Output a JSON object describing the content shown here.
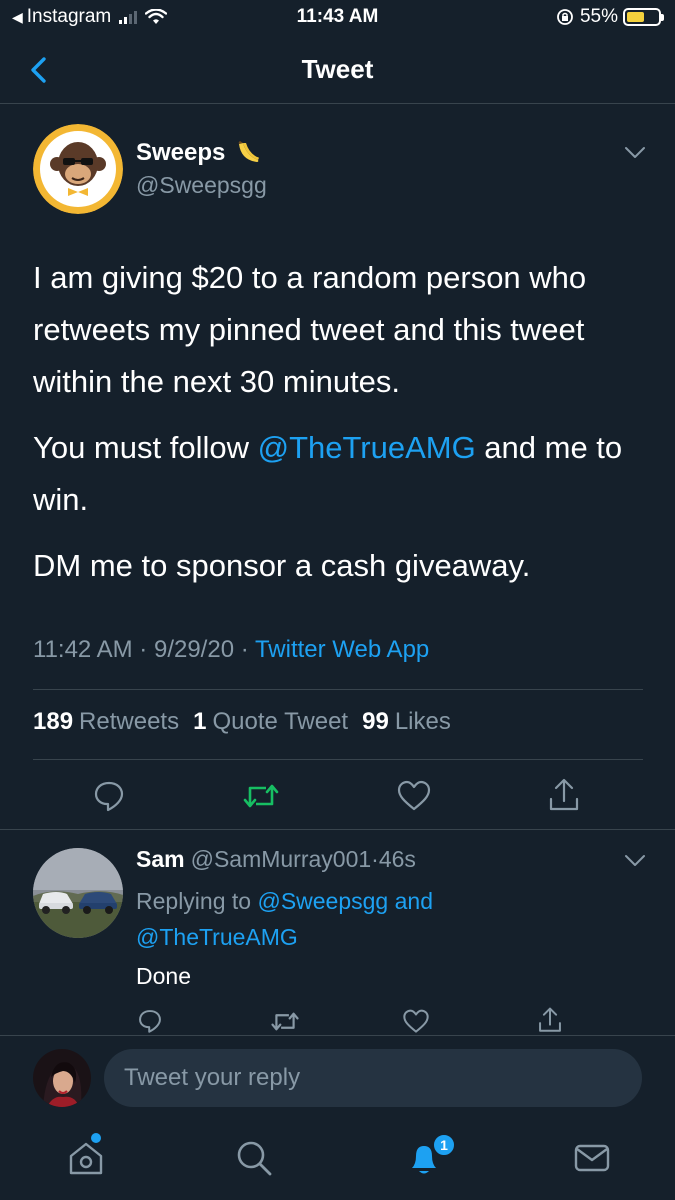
{
  "status_bar": {
    "back_app": "Instagram",
    "time": "11:43 AM",
    "battery": "55%",
    "battery_level": 0.55
  },
  "nav": {
    "title": "Tweet"
  },
  "tweet": {
    "author_name": "Sweeps",
    "author_emoji": "banana",
    "handle": "@Sweepsgg",
    "paragraphs": [
      {
        "text": "I am giving $20 to a random person who retweets my pinned tweet and this tweet within the next 30 minutes."
      },
      {
        "before": "You must follow ",
        "mention": "@TheTrueAMG",
        "after": " and me to win."
      },
      {
        "text": "DM me to sponsor a cash giveaway."
      }
    ],
    "time": "11:42 AM",
    "date": "9/29/20",
    "sep": "·",
    "source": "Twitter Web App",
    "stats": {
      "retweets_count": "189",
      "retweets_label": "Retweets",
      "quotes_count": "1",
      "quotes_label": "Quote Tweet",
      "likes_count": "99",
      "likes_label": "Likes"
    }
  },
  "reply": {
    "name": "Sam",
    "handle": "@SamMurray001",
    "sep": "·",
    "age": "46s",
    "replying_label": "Replying to",
    "replying_1": "@Sweepsgg",
    "and": "and",
    "replying_2": "@TheTrueAMG",
    "text": "Done"
  },
  "compose": {
    "placeholder": "Tweet your reply"
  },
  "tabbar": {
    "notifications_badge": "1"
  },
  "colors": {
    "background": "#15202b",
    "accent": "#1da1f2",
    "muted": "#8899a6",
    "retweet_green": "#17bf63",
    "divider": "#38444d"
  },
  "icons": [
    "chevron-left-icon",
    "banana-icon",
    "chevron-down-icon",
    "reply-icon",
    "retweet-icon",
    "like-icon",
    "share-icon",
    "home-icon",
    "search-icon",
    "notifications-icon",
    "messages-icon"
  ]
}
